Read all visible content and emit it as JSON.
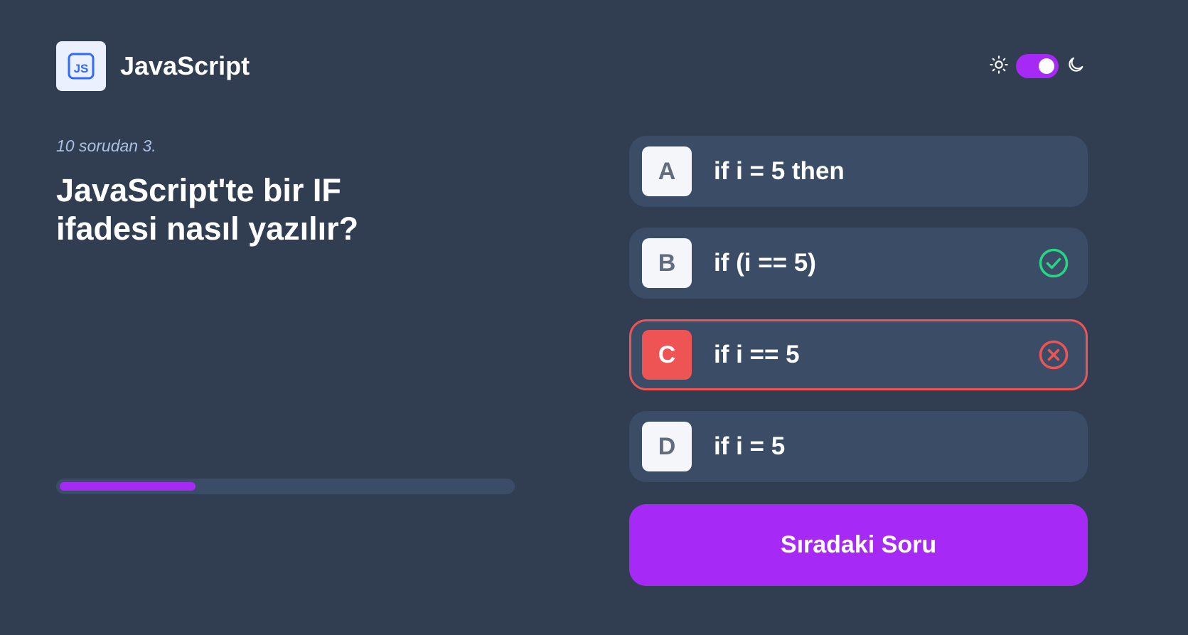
{
  "header": {
    "subject_title": "JavaScript",
    "subject_icon": "js-icon",
    "theme": {
      "light_icon": "sun-icon",
      "dark_icon": "moon-icon",
      "dark_mode_enabled": true
    }
  },
  "quiz": {
    "counter": "10 sorudan 3.",
    "question": "JavaScript'te bir IF ifadesi nasıl yazılır?",
    "progress_fraction": 0.3,
    "options": [
      {
        "letter": "A",
        "text": "if i = 5 then",
        "status": "none"
      },
      {
        "letter": "B",
        "text": "if (i == 5)",
        "status": "correct",
        "icon": "check-circle-icon"
      },
      {
        "letter": "C",
        "text": "if i == 5",
        "status": "wrong",
        "icon": "x-circle-icon"
      },
      {
        "letter": "D",
        "text": "if i = 5",
        "status": "none"
      }
    ],
    "next_button_label": "Sıradaki Soru"
  },
  "colors": {
    "background": "#313e51",
    "card": "#3b4d66",
    "accent": "#a729f5",
    "correct": "#26d782",
    "wrong": "#ee5454"
  }
}
